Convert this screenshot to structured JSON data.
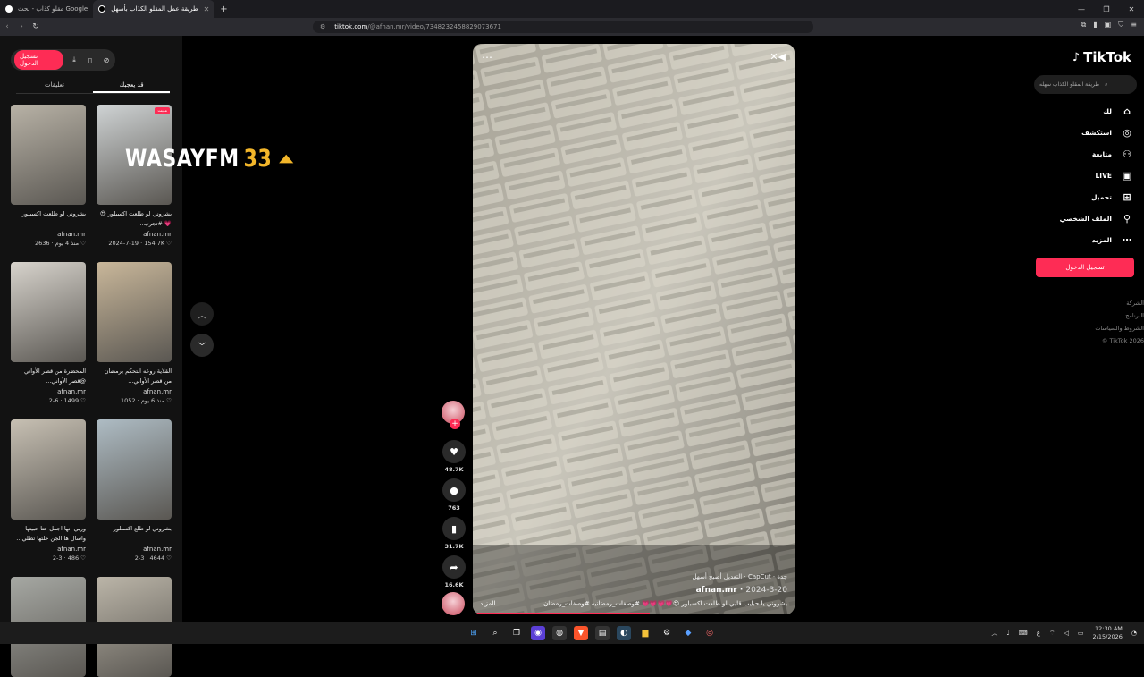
{
  "browser": {
    "tabs": [
      {
        "label": "مقلو كذاب - بحث Google",
        "active": false
      },
      {
        "label": "طريقة عمل المقلو الكذاب بأسهل",
        "active": true
      }
    ],
    "url_host": "tiktok.com",
    "url_path": "/@afnan.mr/video/7348232458829073671"
  },
  "left_panel": {
    "login_label": "تسجيل الدخول",
    "tabs": [
      "تعليقات",
      "قد يعجبك"
    ],
    "cards": [
      {
        "title": "بشروني لو طلعت اكسبلور 😍 💗 #تجرب...",
        "author": "afnan.mr",
        "meta": "2024-7-19 · 154.7K ♡",
        "pinned": "مثبت",
        "thumb": "#cfd3d4"
      },
      {
        "title": "بشروني لو طلعت اكسبلور",
        "author": "afnan.mr",
        "meta": "منذ 4 يوم · 2636 ♡",
        "pinned": "",
        "thumb": "#b8b2a6"
      },
      {
        "title": "القلاية روعه التحكم برمضان من قصر الأواني...",
        "author": "afnan.mr",
        "meta": "منذ 6 يوم · 1052 ♡",
        "pinned": "",
        "thumb": "#c9b79a"
      },
      {
        "title": "المحضرة من قصر الأواني @قصر الأواني...",
        "author": "afnan.mr",
        "meta": "2-6 · 1499 ♡",
        "pinned": "",
        "thumb": "#d7d3cc"
      },
      {
        "title": "بشروني لو طلع اكسبلور",
        "author": "afnan.mr",
        "meta": "2-3 · 4644 ♡",
        "pinned": "",
        "thumb": "#aebcc4"
      },
      {
        "title": "وربي انها اجمل حتا حبيتها واسال ها الجن حلتها تطلي...",
        "author": "afnan.mr",
        "meta": "2-3 · 486 ♡",
        "pinned": "",
        "thumb": "#c7c0b3"
      },
      {
        "title": "",
        "author": "",
        "meta": "",
        "pinned": "",
        "thumb": "#bbb5a8"
      },
      {
        "title": "",
        "author": "",
        "meta": "",
        "pinned": "",
        "thumb": "#a6a8a3"
      }
    ]
  },
  "overlay": {
    "brand": "WASAYFM",
    "number": "33"
  },
  "video": {
    "line1": "جدة · CapCut · التعديل أصبح أسهل",
    "author": "afnan.mr",
    "date": "2024-3-20",
    "caption": "بشروني يا حبايب قلبي لو طلعت اكسبلور 😍💗💗💗💗 #وصفات_رمضانيه #وصفات_رمضان ...",
    "more": "المزيد",
    "progress": 0.55
  },
  "actions": {
    "likes": "48.7K",
    "comments": "763",
    "saves": "31.7K",
    "shares": "16.6K"
  },
  "sidebar": {
    "logo": "TikTok",
    "search_placeholder": "طريقة المقلو الكذاب سهله",
    "nav": [
      "لك",
      "استكشف",
      "متابعة",
      "LIVE",
      "تحميل",
      "الملف الشخصي",
      "المزيد"
    ],
    "login_label": "تسجيل الدخول",
    "footer": [
      "الشركة",
      "البرنامج",
      "الشروط والسياسات",
      "© TikTok 2026"
    ]
  },
  "taskbar": {
    "time": "12:30 AM",
    "date": "2/15/2026",
    "lang": "ع"
  }
}
